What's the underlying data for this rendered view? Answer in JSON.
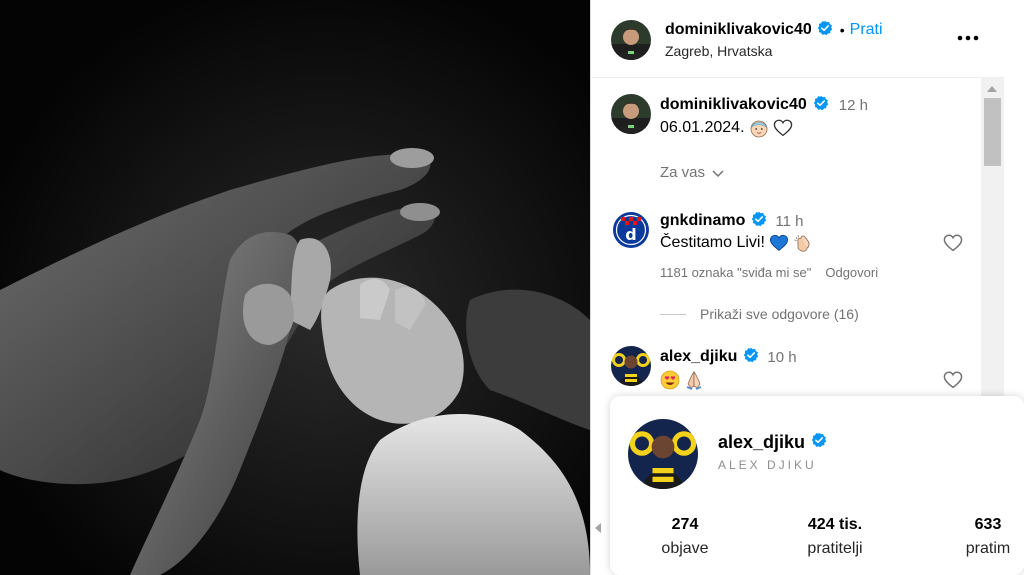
{
  "post": {
    "photo_description_alt": "",
    "author": {
      "username": "dominiklivakovic40",
      "follow_label": "Prati",
      "separator": "•",
      "location": "Zagreb, Hrvatska"
    },
    "more_icon": "ellipsis-icon",
    "caption": {
      "username": "dominiklivakovic40",
      "time": "12 h",
      "text": "06.01.2024."
    },
    "for_you_label": "Za vas"
  },
  "comments": [
    {
      "username": "gnkdinamo",
      "time": "11 h",
      "text": "Čestitamo Livi!",
      "likes": "1181 oznaka \"sviđa mi se\"",
      "reply_label": "Odgovori",
      "view_replies": "Prikaži sve odgovore (16)"
    },
    {
      "username": "alex_djiku",
      "time": "10 h",
      "text": ""
    }
  ],
  "hovercard": {
    "username": "alex_djiku",
    "subtitle": "ALEX DJIKU",
    "stats": [
      {
        "value": "274",
        "label": "objave"
      },
      {
        "value": "424 tis.",
        "label": "pratitelji"
      },
      {
        "value": "633",
        "label": "pratim"
      }
    ]
  },
  "colors": {
    "accent": "#0095f6",
    "verified": "#0095f6",
    "muted": "#737373"
  }
}
